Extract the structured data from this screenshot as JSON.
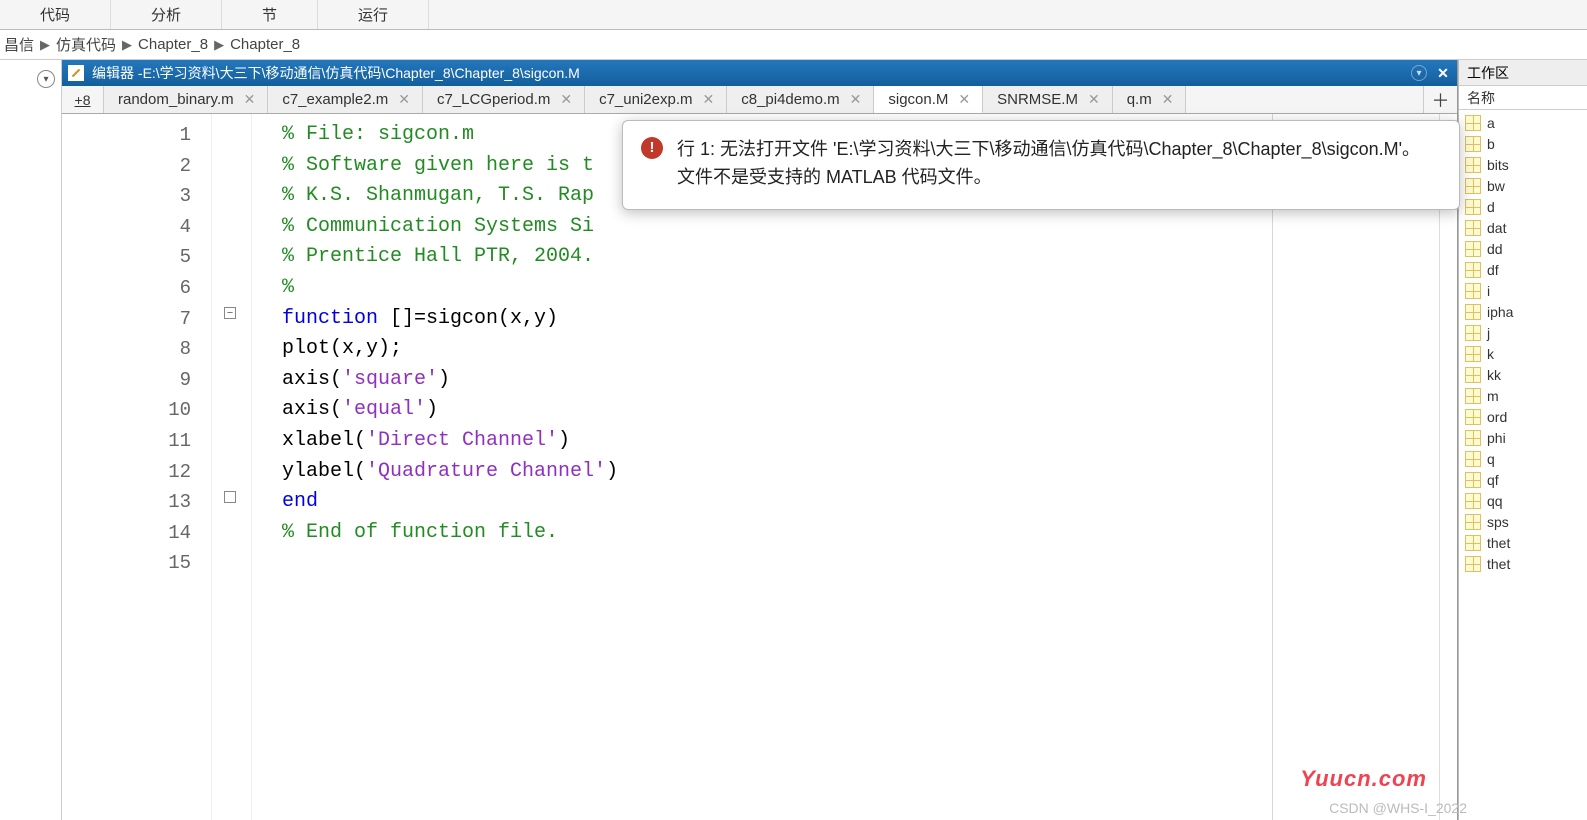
{
  "toolstrip": {
    "items": [
      "代码",
      "分析",
      "节",
      "运行"
    ]
  },
  "path": [
    "昌信",
    "仿真代码",
    "Chapter_8",
    "Chapter_8"
  ],
  "editor": {
    "title_prefix": "编辑器 - ",
    "title_path": "E:\\学习资料\\大三下\\移动通信\\仿真代码\\Chapter_8\\Chapter_8\\sigcon.M",
    "overflow_badge": "+8",
    "tabs": [
      {
        "name": "random_binary.m",
        "active": false
      },
      {
        "name": "c7_example2.m",
        "active": false
      },
      {
        "name": "c7_LCGperiod.m",
        "active": false
      },
      {
        "name": "c7_uni2exp.m",
        "active": false
      },
      {
        "name": "c8_pi4demo.m",
        "active": false
      },
      {
        "name": "sigcon.M",
        "active": true
      },
      {
        "name": "SNRMSE.M",
        "active": false
      },
      {
        "name": "q.m",
        "active": false
      }
    ],
    "code_lines": [
      [
        {
          "t": "% File: sigcon.m",
          "c": "c-comment"
        }
      ],
      [
        {
          "t": "% Software given here is t",
          "c": "c-comment"
        }
      ],
      [
        {
          "t": "% K.S. Shanmugan, T.S. Rap",
          "c": "c-comment"
        }
      ],
      [
        {
          "t": "% Communication Systems Si",
          "c": "c-comment"
        }
      ],
      [
        {
          "t": "% Prentice Hall PTR, 2004.",
          "c": "c-comment"
        }
      ],
      [
        {
          "t": "%",
          "c": "c-comment"
        }
      ],
      [
        {
          "t": "function ",
          "c": "c-keyword"
        },
        {
          "t": "[]=sigcon(x,y)",
          "c": ""
        }
      ],
      [
        {
          "t": "plot(x,y);",
          "c": ""
        }
      ],
      [
        {
          "t": "axis(",
          "c": ""
        },
        {
          "t": "'square'",
          "c": "c-string"
        },
        {
          "t": ")",
          "c": ""
        }
      ],
      [
        {
          "t": "axis(",
          "c": ""
        },
        {
          "t": "'equal'",
          "c": "c-string"
        },
        {
          "t": ")",
          "c": ""
        }
      ],
      [
        {
          "t": "xlabel(",
          "c": ""
        },
        {
          "t": "'Direct Channel'",
          "c": "c-string"
        },
        {
          "t": ")",
          "c": ""
        }
      ],
      [
        {
          "t": "ylabel(",
          "c": ""
        },
        {
          "t": "'Quadrature Channel'",
          "c": "c-string"
        },
        {
          "t": ")",
          "c": ""
        }
      ],
      [
        {
          "t": "end",
          "c": "c-keyword"
        }
      ],
      [
        {
          "t": "% End of function file.",
          "c": "c-comment"
        }
      ],
      [
        {
          "t": "",
          "c": ""
        }
      ]
    ]
  },
  "error": {
    "prefix": "行 1: ",
    "message": "无法打开文件 'E:\\学习资料\\大三下\\移动通信\\仿真代码\\Chapter_8\\Chapter_8\\sigcon.M'。文件不是受支持的 MATLAB 代码文件。"
  },
  "workspace": {
    "panel_title": "工作区",
    "header": "名称",
    "vars": [
      "a",
      "b",
      "bits",
      "bw",
      "d",
      "dat",
      "dd",
      "df",
      "i",
      "ipha",
      "j",
      "k",
      "kk",
      "m",
      "ord",
      "phi",
      "q",
      "qf",
      "qq",
      "sps",
      "thet",
      "thet"
    ]
  },
  "watermark1": "Yuucn.com",
  "watermark2": "CSDN @WHS-I_2022"
}
